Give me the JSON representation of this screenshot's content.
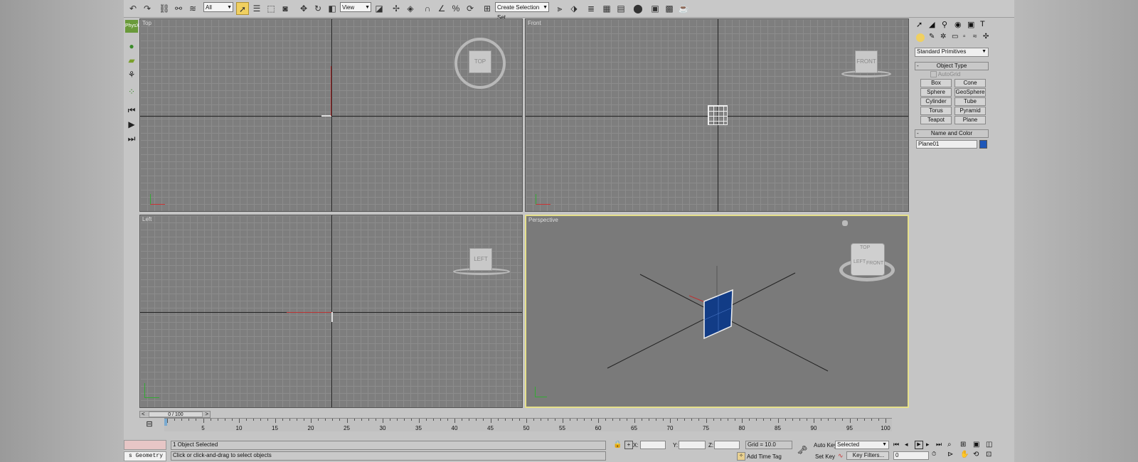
{
  "toolbar": {
    "selection_filter": "All",
    "reference_coord": "View",
    "named_selection_set": "Create Selection Set"
  },
  "viewports": {
    "top": {
      "label": "Top",
      "cube": "TOP"
    },
    "front": {
      "label": "Front",
      "cube": "FRONT"
    },
    "left": {
      "label": "Left",
      "cube": "LEFT"
    },
    "perspective": {
      "label": "Perspective",
      "cube_left": "LEFT",
      "cube_front": "FRONT",
      "cube_top": "TOP"
    }
  },
  "command_panel": {
    "category_dropdown": "Standard Primitives",
    "object_type_title": "Object Type",
    "autogrid_label": "AutoGrid",
    "primitives": [
      "Box",
      "Cone",
      "Sphere",
      "GeoSphere",
      "Cylinder",
      "Tube",
      "Torus",
      "Pyramid",
      "Teapot",
      "Plane"
    ],
    "name_color_title": "Name and Color",
    "object_name": "Plane01",
    "object_color": "#1e57b8"
  },
  "timeline": {
    "frame_counter": "0 / 100",
    "ticks": [
      "5",
      "10",
      "15",
      "20",
      "25",
      "30",
      "35",
      "40",
      "45",
      "50",
      "55",
      "60",
      "65",
      "70",
      "75",
      "80",
      "85",
      "90",
      "95",
      "100"
    ]
  },
  "status": {
    "script_label": "s Geometry",
    "selection_status": "1 Object Selected",
    "prompt": "Click or click-and-drag to select objects",
    "x_label": "X:",
    "y_label": "Y:",
    "z_label": "Z:",
    "grid": "Grid = 10.0",
    "add_time_tag": "Add Time Tag",
    "auto_key": "Auto Key",
    "set_key": "Set Key",
    "key_mode": "Selected",
    "key_filters": "Key Filters...",
    "current_frame": "0"
  },
  "colors": {
    "selection_highlight": "#e6e08a",
    "plane_fill": "#123c86"
  }
}
